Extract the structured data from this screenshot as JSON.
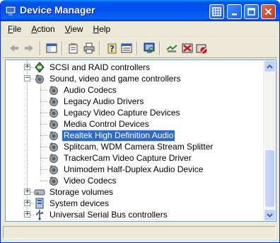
{
  "window": {
    "title": "Device Manager",
    "accent": "#0054e3",
    "selection_color": "#316ac5"
  },
  "menubar": {
    "items": [
      {
        "label": "File",
        "underline": "F"
      },
      {
        "label": "Action",
        "underline": "A"
      },
      {
        "label": "View",
        "underline": "V"
      },
      {
        "label": "Help",
        "underline": "H"
      }
    ]
  },
  "toolbar": {
    "buttons": [
      "back-icon",
      "forward-icon",
      "show-hide-console-tree-icon",
      "properties-icon",
      "print-icon",
      "help-icon",
      "view-icon",
      "scan-hardware-icon",
      "update-driver-icon",
      "disable-device-icon",
      "uninstall-device-icon"
    ]
  },
  "tree": {
    "items": [
      {
        "label": "SCSI and RAID controllers",
        "icon": "scsi-controller-icon",
        "expander": "+"
      },
      {
        "label": "Sound, video and game controllers",
        "icon": "sound-device-icon",
        "expander": "−"
      },
      {
        "label": "Audio Codecs",
        "icon": "sound-device-icon"
      },
      {
        "label": "Legacy Audio Drivers",
        "icon": "sound-device-icon"
      },
      {
        "label": "Legacy Video Capture Devices",
        "icon": "sound-device-icon"
      },
      {
        "label": "Media Control Devices",
        "icon": "sound-device-icon"
      },
      {
        "label": "Realtek High Definition Audio",
        "icon": "sound-device-icon",
        "selected": true
      },
      {
        "label": "Splitcam, WDM Camera Stream Splitter",
        "icon": "sound-device-icon"
      },
      {
        "label": "TrackerCam Video Capture Driver",
        "icon": "sound-device-icon"
      },
      {
        "label": "Unimodem Half-Duplex Audio Device",
        "icon": "sound-device-icon"
      },
      {
        "label": "Video Codecs",
        "icon": "sound-device-icon"
      },
      {
        "label": "Storage volumes",
        "icon": "storage-volume-icon",
        "expander": "+"
      },
      {
        "label": "System devices",
        "icon": "system-device-icon",
        "expander": "+"
      },
      {
        "label": "Universal Serial Bus controllers",
        "icon": "usb-icon",
        "expander": "+"
      }
    ]
  },
  "statusbar": {
    "text": ""
  }
}
